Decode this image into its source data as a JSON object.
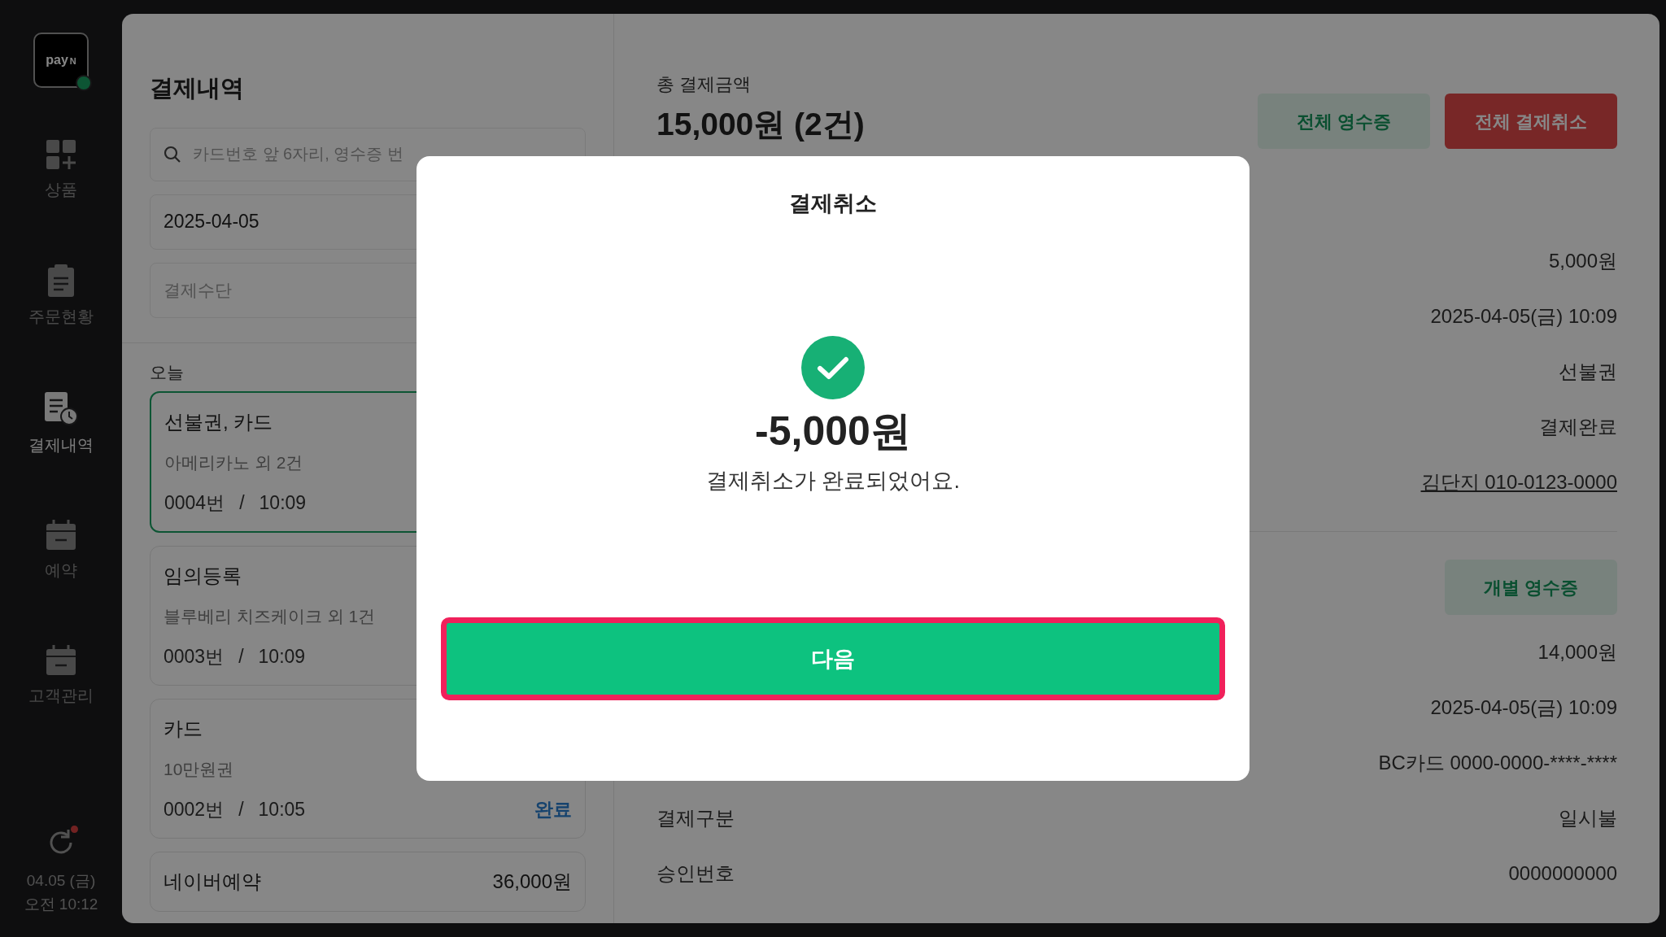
{
  "sidebar": {
    "logo": "pay",
    "logo_mark": "N",
    "items": [
      {
        "kind": "grid",
        "label": "상품",
        "selected": false
      },
      {
        "kind": "clipboard",
        "label": "주문현황",
        "selected": false
      },
      {
        "kind": "receipt",
        "label": "결제내역",
        "selected": true
      },
      {
        "kind": "calendar",
        "label": "예약",
        "selected": false
      },
      {
        "kind": "calendar",
        "label": "고객관리",
        "selected": false
      }
    ],
    "date": "04.05 (금)",
    "time": "오전 10:12"
  },
  "list_panel": {
    "title": "결제내역",
    "search": {
      "placeholder": "카드번호 앞 6자리, 영수증 번"
    },
    "date_field": {
      "value": "2025-04-05"
    },
    "method_field": {
      "placeholder": "결제수단"
    },
    "group": "오늘",
    "cards": [
      {
        "title": "선불권, 카드",
        "subtitle": "아메리카노 외 2건",
        "number": "0004번",
        "separator": "/",
        "time": "10:09",
        "selected": true
      },
      {
        "title": "임의등록",
        "subtitle": "블루베리 치즈케이크 외 1건",
        "number": "0003번",
        "separator": "/",
        "time": "10:09",
        "selected": false
      },
      {
        "title": "카드",
        "subtitle": "10만원권",
        "number": "0002번",
        "separator": "/",
        "time": "10:05",
        "status": "완료",
        "selected": false
      },
      {
        "title": "네이버예약",
        "amount": "36,000원",
        "selected": false
      }
    ]
  },
  "detail": {
    "total_label": "총 결제금액",
    "total": "15,000원 (2건)",
    "buttons": [
      {
        "kind": "receipt",
        "label": "전체 영수증"
      },
      {
        "kind": "cancel",
        "label": "전체 결제취소"
      }
    ],
    "groups": [
      {
        "rows": [
          {
            "value": "5,000원"
          },
          {
            "value": "2025-04-05(금) 10:09"
          },
          {
            "value": "선불권"
          },
          {
            "value": "결제완료"
          },
          {
            "value": "김단지 010-0123-0000",
            "kind": "link"
          }
        ]
      },
      {
        "button": "개별 영수증",
        "rows": [
          {
            "value": "14,000원"
          },
          {
            "value": "2025-04-05(금) 10:09"
          },
          {
            "value": "BC카드 0000-0000-****-****"
          },
          {
            "label": "결제구분",
            "value": "일시불"
          },
          {
            "label": "승인번호",
            "value": "0000000000"
          }
        ]
      }
    ]
  },
  "modal": {
    "title": "결제취소",
    "amount": "-5,000원",
    "message": "결제취소가 완료되었어요.",
    "button": "다음"
  }
}
